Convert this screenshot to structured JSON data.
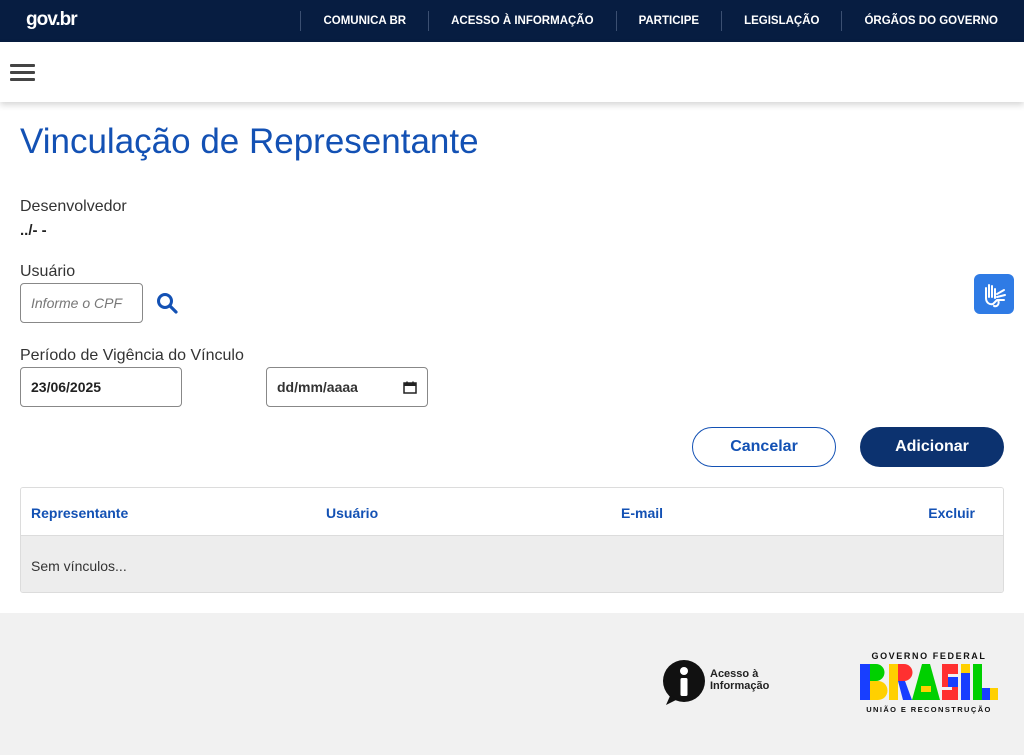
{
  "topbar": {
    "logo": "gov.br",
    "links": [
      "COMUNICA BR",
      "ACESSO À INFORMAÇÃO",
      "PARTICIPE",
      "LEGISLAÇÃO",
      "ÓRGÃOS DO GOVERNO"
    ]
  },
  "page": {
    "title": "Vinculação de Representante"
  },
  "form": {
    "developer_label": "Desenvolvedor",
    "developer_value": "../- -",
    "user_label": "Usuário",
    "cpf_placeholder": "Informe o CPF",
    "period_label": "Período de Vigência do Vínculo",
    "start_date": "23/06/2025",
    "end_date_placeholder": "dd/mm/aaaa"
  },
  "actions": {
    "cancel_label": "Cancelar",
    "add_label": "Adicionar"
  },
  "table": {
    "columns": [
      "Representante",
      "Usuário",
      "E-mail",
      "Excluir"
    ],
    "empty_text": "Sem vínculos..."
  },
  "footer": {
    "access_info": "Acesso à Informação",
    "gov_top": "GOVERNO FEDERAL",
    "gov_word": "BRASIL",
    "gov_bottom": "UNIÃO E RECONSTRUÇÃO"
  },
  "colors": {
    "topbar_bg": "#071d41",
    "primary_blue": "#1351b4",
    "button_dark": "#0c326f",
    "vlibras_bg": "#2f7be5",
    "footer_bg": "#f1f1f1"
  },
  "icons": {
    "menu": "hamburger-menu-icon",
    "search": "search-icon",
    "calendar": "calendar-icon",
    "accessibility": "vlibras-hands-icon",
    "access_info": "information-icon"
  }
}
